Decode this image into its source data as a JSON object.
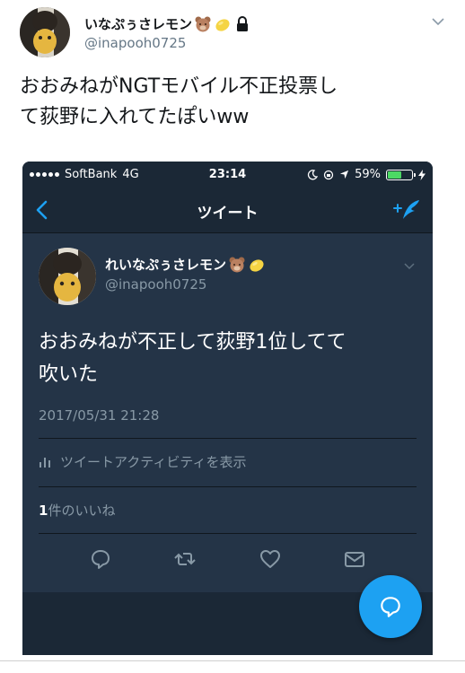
{
  "outer_tweet": {
    "display_name": "いなぷぅさレモン",
    "handle": "@inapooh0725",
    "text_line1": "おおみねがNGTモバイル不正投票し",
    "text_line2": "て荻野に入れてたぽいww"
  },
  "phone": {
    "status_bar": {
      "carrier": "SoftBank",
      "network": "4G",
      "time": "23:14",
      "battery": "59%",
      "battery_level": 0.59
    },
    "nav": {
      "title": "ツイート"
    },
    "tweet": {
      "display_name": "れいなぷぅさレモン",
      "handle": "@inapooh0725",
      "text_line1": "おおみねが不正して荻野1位してて",
      "text_line2": "吹いた",
      "timestamp": "2017/05/31 21:28",
      "activity_label": "ツイートアクティビティを表示",
      "likes_count": "1",
      "likes_suffix": "件のいいね"
    }
  },
  "colors": {
    "accent": "#1da1f2",
    "dark_bg": "#243447",
    "darker_bg": "#1b2836",
    "muted_text": "#8899a6"
  }
}
